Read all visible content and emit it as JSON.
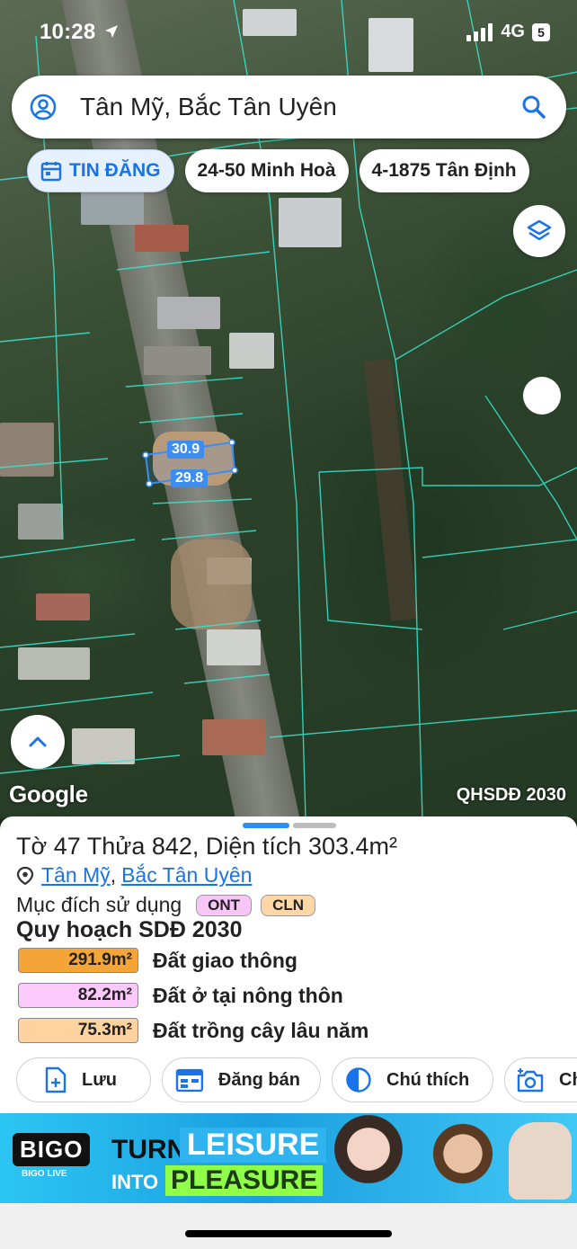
{
  "status_bar": {
    "time": "10:28",
    "network": "4G",
    "badge": "5"
  },
  "search": {
    "query": "Tân Mỹ, Bắc Tân Uyên"
  },
  "chips": [
    {
      "label": "TIN ĐĂNG"
    },
    {
      "label": "24-50 Minh Hoà"
    },
    {
      "label": "4-1875 Tân Định"
    }
  ],
  "map": {
    "measure_top": "30.9",
    "measure_bottom": "29.8",
    "attribution": "Google",
    "layer_label": "QHSDĐ 2030"
  },
  "parcel": {
    "title": "Tờ 47 Thửa 842, Diện tích 303.4m²",
    "location_commune": "Tân Mỹ",
    "location_sep": ",",
    "location_district": "Bắc Tân Uyên",
    "purpose_label": "Mục đích sử dụng",
    "purpose_tags": [
      "ONT",
      "CLN"
    ],
    "plan_title": "Quy hoạch SDĐ 2030",
    "plan_rows": [
      {
        "area": "291.9m²",
        "name": "Đất giao thông",
        "color": "#f5a437"
      },
      {
        "area": "82.2m²",
        "name": "Đất ở tại nông thôn",
        "color": "#fbc9fb"
      },
      {
        "area": "75.3m²",
        "name": "Đất trồng cây lâu năm",
        "color": "#ffd2a0"
      }
    ]
  },
  "actions": [
    {
      "label": "Lưu",
      "icon": "file-add-icon"
    },
    {
      "label": "Đăng bán",
      "icon": "listing-icon"
    },
    {
      "label": "Chú thích",
      "icon": "half-circle-icon"
    },
    {
      "label": "Ch",
      "icon": "camera-add-icon"
    }
  ],
  "ad": {
    "brand": "BIGO",
    "brand_sub": "BIGO LIVE",
    "turn": "TURN",
    "into": "INTO",
    "leisure": "LEISURE",
    "pleasure": "PLEASURE"
  },
  "colors": {
    "accent": "#1a73e8",
    "parcel_line": "#39e6d0"
  }
}
